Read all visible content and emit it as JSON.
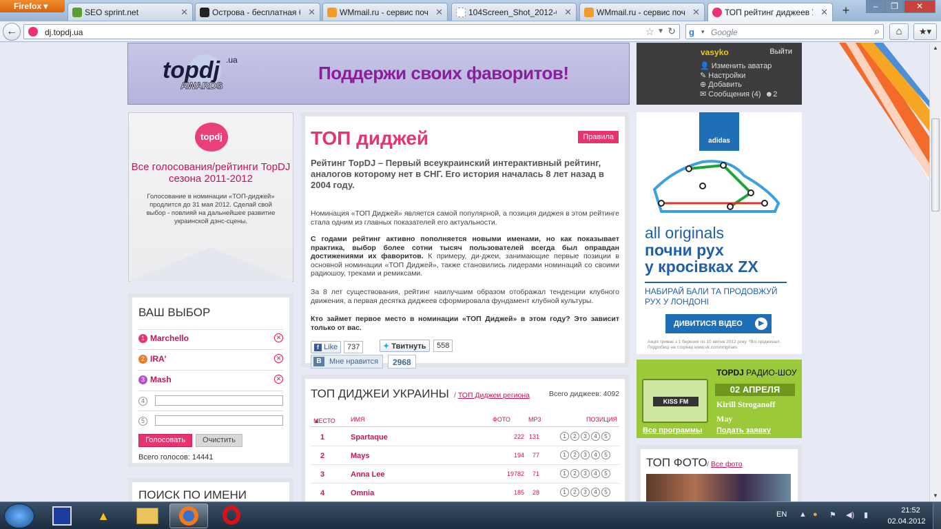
{
  "browser": {
    "menu_label": "Firefox",
    "tabs": [
      {
        "title": "SEO sprint.net",
        "color": "#5aa02c"
      },
      {
        "title": "Острова - бесплатная б...",
        "color": "#222222"
      },
      {
        "title": "WMmail.ru - сервис поч...",
        "color": "#f39b2a"
      },
      {
        "title": "104Screen_Shot_2012-03-...",
        "color": "#cccccc"
      },
      {
        "title": "WMmail.ru - сервис почт...",
        "color": "#f39b2a"
      },
      {
        "title": "ТОП рейтинг диджеев У...",
        "color": "#e8336f"
      }
    ],
    "url": "dj.topdj.ua",
    "search_placeholder": "Google"
  },
  "banner": {
    "logo_text": "topdj.ua AWARDS",
    "slogan": "Поддержи своих фаворитов!"
  },
  "user": {
    "name": "vasyko",
    "logout": "Выйти",
    "menu": [
      "Изменить аватар",
      "Настройки",
      "Добавить",
      "Сообщения (4)"
    ],
    "friends_count": "2"
  },
  "vote_promo": {
    "logo": "topdj",
    "title": "Все голосования/рейтинги TopDJ сезона 2011-2012",
    "text": "Голосование в номинации «ТОП-диджей» продлится до 31 мая 2012. Сделай свой выбор - повлияй на дальнейшее развитие украинской дэнс-сцены."
  },
  "choice": {
    "title": "ВАШ ВЫБОР",
    "picks": [
      {
        "num": "1",
        "name": "Marchello",
        "color": "#e9336c"
      },
      {
        "num": "2",
        "name": "IRA'",
        "color": "#f07a1e"
      },
      {
        "num": "3",
        "name": "Mash",
        "color": "#b84fd0"
      }
    ],
    "empty": [
      "4",
      "5"
    ],
    "vote_btn": "Голосовать",
    "clear_btn": "Очистить",
    "total": "Всего голосов: 14441"
  },
  "search_panel": {
    "title": "ПОИСК ПО ИМЕНИ"
  },
  "intro": {
    "title": "ТОП диджей",
    "rules": "Правила",
    "lead": "Рейтинг TopDJ – Первый всеукраинский интерактивный рейтинг, аналогов которому нет в СНГ. Его история началась 8 лет назад в 2004 году.",
    "p1": "Номинация «ТОП Диджей» является самой популярной, а позиция диджея в этом рейтинге стала одним из главных показателей его актуальности.",
    "p2_bold": "С годами рейтинг активно пополняется новыми именами, но как показывает практика, выбор более сотни тысяч пользователей всегда был оправдан достижениями их фаворитов.",
    "p2_rest": " К примеру, ди-джеи, занимающие первые позиции в основной номинации «ТОП Диджей», также становились лидерами номинаций со своими радиошоу, треками и ремиксами.",
    "p3": "За 8 лет существования, рейтинг наилучшим образом отображал тенденции клубного движения, а первая десятка диджеев сформировала фундамент клубной культуры.",
    "p4": "Кто займет первое место в номинации «ТОП Диджей» в этом году? Это зависит только от вас.",
    "fb_like": "Like",
    "fb_count": "737",
    "tw_label": "Твитнуть",
    "tw_count": "558",
    "vk_label": "Мне нравится",
    "vk_count": "2968"
  },
  "table": {
    "title": "ТОП ДИДЖЕИ УКРАИНЫ",
    "sub_prefix": "/",
    "sub_link": "ТОП Диджеи региона",
    "total": "Всего диджеев: 4092",
    "headers": {
      "place": "МЕСТО",
      "name": "ИМЯ",
      "photo": "ФОТО",
      "mp3": "MP3",
      "position": "ПОЗИЦИЯ"
    },
    "rows": [
      {
        "place": "1",
        "name": "Spartaque",
        "photo": "222",
        "mp3": "131"
      },
      {
        "place": "2",
        "name": "Mays",
        "photo": "194",
        "mp3": "77"
      },
      {
        "place": "3",
        "name": "Anna Lee",
        "photo": "19782",
        "mp3": "71"
      },
      {
        "place": "4",
        "name": "Omnia",
        "photo": "185",
        "mp3": "28"
      }
    ],
    "rank_buttons": [
      "1",
      "2",
      "3",
      "4",
      "5"
    ]
  },
  "adidas": {
    "logo": "adidas",
    "line1": "all originals",
    "line2": "почни рух",
    "line3": "у кросівках ZX",
    "line4": "НАБИРАЙ БАЛИ ТА ПРОДОВЖУЙ РУХ У ЛОНДОНІ",
    "btn": "ДИВИТИСЯ ВІДЕО",
    "small": "Акція триває з 1 березня по 10 квітня 2012 року. *Всі оріджинал. Подробиці на сторінці www.vk.com/originals"
  },
  "radio": {
    "box": "KISS FM",
    "title_bold": "TOPDJ",
    "title_rest": " РАДИО-ШОУ",
    "date": "02 АПРЕЛЯ",
    "dj1": "Kirill Stroganoff",
    "dj2": "May",
    "all_link": "Все программы",
    "apply_link": "Подать заявку"
  },
  "photo": {
    "title": "ТОП ФОТО",
    "sub_prefix": "/",
    "sub_link": "Все фото"
  },
  "taskbar": {
    "lang": "EN",
    "time": "21:52",
    "date": "02.04.2012"
  }
}
